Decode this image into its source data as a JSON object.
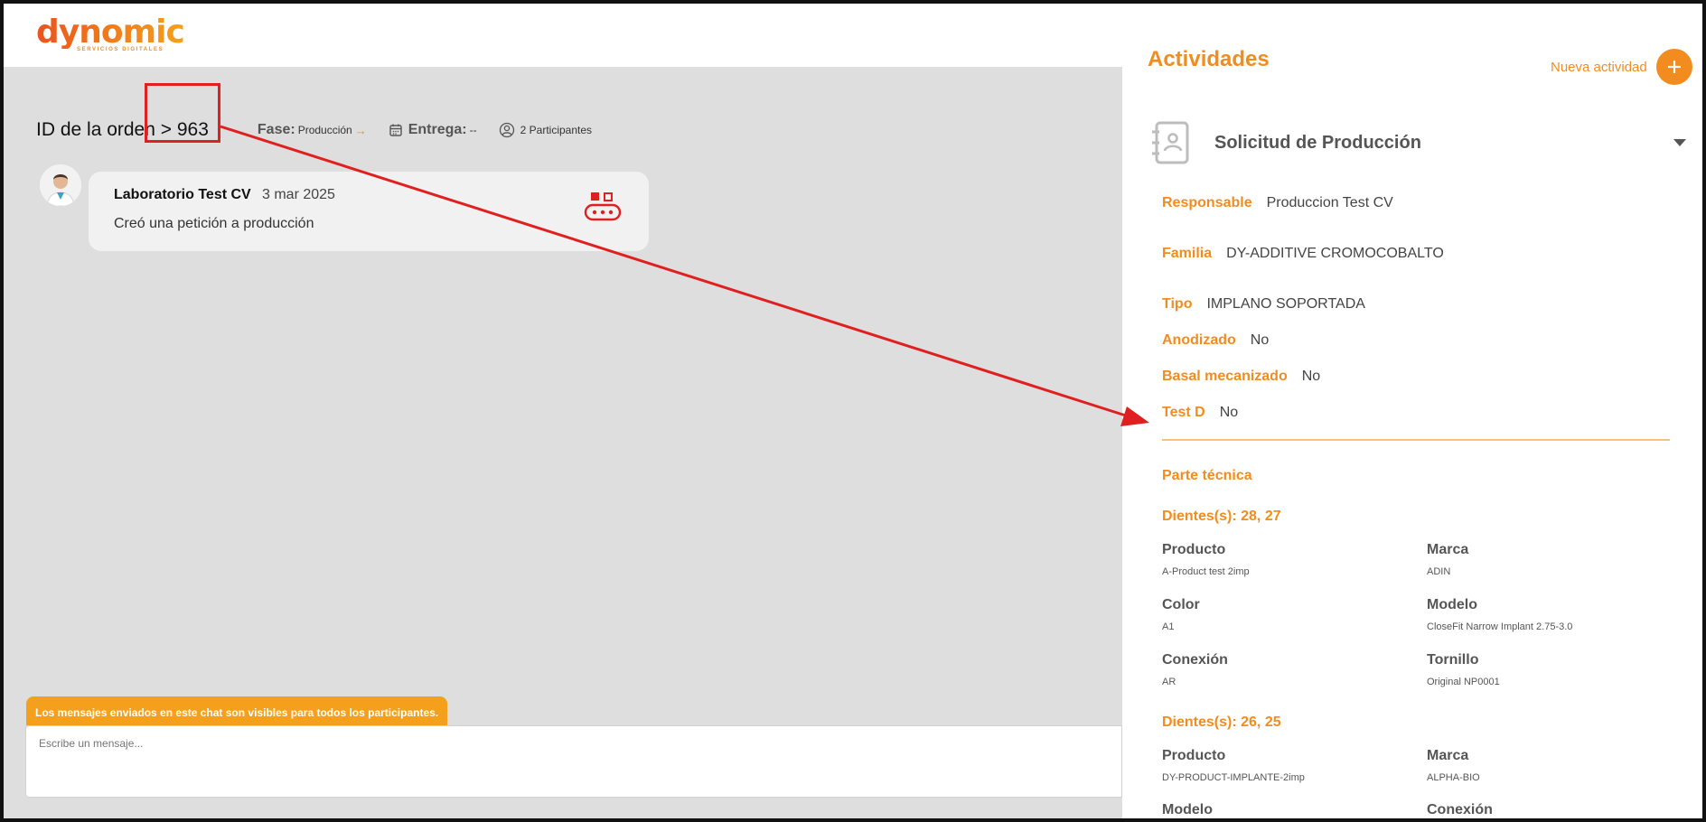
{
  "brand": {
    "name": "dynomic",
    "tagline": "SERVICIOS DIGITALES"
  },
  "order": {
    "title": "ID de la orden > 963",
    "phase_label": "Fase:",
    "phase_value": "Producción",
    "phase_arrow": "→",
    "delivery_label": "Entrega:",
    "delivery_value": "--",
    "participants": "2 Participantes"
  },
  "message": {
    "sender": "Laboratorio Test CV",
    "date": "3 mar 2025",
    "text": "Creó una petición a producción"
  },
  "chat": {
    "notice": "Los mensajes enviados en este chat son visibles para todos los participantes.",
    "placeholder": "Escribe un mensaje..."
  },
  "panel": {
    "title": "Actividades",
    "new_activity": "Nueva actividad",
    "section_title": "Solicitud de Producción",
    "fields": [
      {
        "label": "Responsable",
        "value": "Produccion Test CV"
      },
      {
        "label": "Familia",
        "value": "DY-ADDITIVE CROMOCOBALTO"
      },
      {
        "label": "Tipo",
        "value": "IMPLANO SOPORTADA"
      },
      {
        "label": "Anodizado",
        "value": "No"
      },
      {
        "label": "Basal mecanizado",
        "value": "No"
      },
      {
        "label": "Test D",
        "value": "No"
      }
    ],
    "technical_title": "Parte técnica",
    "teeth_groups": [
      {
        "title": "Dientes(s): 28, 27",
        "items": [
          {
            "label": "Producto",
            "value": "A-Product test 2imp"
          },
          {
            "label": "Marca",
            "value": "ADIN"
          },
          {
            "label": "Color",
            "value": "A1"
          },
          {
            "label": "Modelo",
            "value": "CloseFit Narrow Implant 2.75-3.0"
          },
          {
            "label": "Conexión",
            "value": "AR"
          },
          {
            "label": "Tornillo",
            "value": "Original NP0001"
          }
        ]
      },
      {
        "title": "Dientes(s): 26, 25",
        "items": [
          {
            "label": "Producto",
            "value": "DY-PRODUCT-IMPLANTE-2imp"
          },
          {
            "label": "Marca",
            "value": "ALPHA-BIO"
          },
          {
            "label": "Modelo",
            "value": ""
          },
          {
            "label": "Conexión",
            "value": ""
          }
        ]
      }
    ]
  },
  "colors": {
    "accent": "#f28c1e",
    "annotation": "#e02020",
    "chat_bg": "#dedede"
  }
}
